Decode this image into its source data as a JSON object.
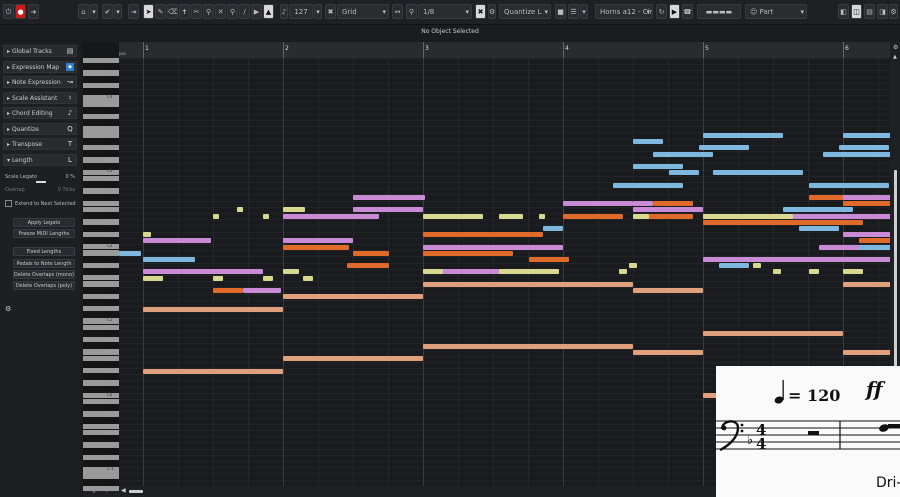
{
  "toolbar": {
    "snap_value": "127",
    "grid_type": "Grid",
    "grid_value": "1/8",
    "quantize": "Quantize L",
    "track_name": "Horns a12 - Cin.",
    "part_label": "Part"
  },
  "status": {
    "text": "No Object Selected"
  },
  "inspector": {
    "sections": [
      "Global Tracks",
      "Expression Map",
      "Note Expression",
      "Scale Assistant",
      "Chord Editing",
      "Quantize",
      "Transpose",
      "Length"
    ],
    "scale_legato_label": "Scale Legato",
    "scale_legato_value": "0 %",
    "overlap_label": "Overlap",
    "overlap_value": "0 Ticks",
    "extend_label": "Extend to Next Selected",
    "buttons": [
      "Apply Legato",
      "Freeze MIDI Lengths",
      "Fixed Lengths",
      "Pedals to Note Length",
      "Delete Overlaps (mono)",
      "Delete Overlaps (poly)"
    ]
  },
  "ruler": {
    "bars": [
      "1",
      "2",
      "3",
      "4",
      "5",
      "6"
    ],
    "start_label": "pos"
  },
  "piano": {
    "octave_labels": [
      "C4",
      "C3",
      "C2",
      "C1",
      "C0",
      "C-1"
    ]
  },
  "score": {
    "tempo_value": "= 120",
    "dynamic": "ff",
    "lyric": "Dri-"
  },
  "colors": {
    "orange": "#e06a2a",
    "salmon": "#e0a07c",
    "blue": "#7fb8df",
    "violet": "#c98ad6",
    "yellow": "#d8d890",
    "accent": "#2f7fd0"
  },
  "notes": [
    [
      "blue",
      0,
      6,
      58
    ],
    [
      "blue",
      1,
      20,
      58
    ],
    [
      "blue",
      1,
      136,
      58
    ],
    [
      "violet",
      1,
      30,
      44
    ],
    [
      "yellow",
      1,
      6,
      55
    ],
    [
      "yellow",
      1,
      21,
      57
    ],
    [
      "orange",
      1,
      73,
      84
    ],
    [
      "yellow",
      1,
      46,
      56
    ],
    [
      "yellow",
      1,
      76,
      78
    ],
    [
      "violet",
      1,
      57,
      56
    ],
    [
      "violet",
      1,
      68,
      60
    ],
    [
      "yellow",
      1,
      59,
      49
    ],
    [
      "salmon",
      1,
      35,
      67
    ],
    [
      "salmon",
      1,
      55,
      77
    ],
    [
      "violet",
      2,
      75,
      66
    ],
    [
      "orange",
      2,
      21,
      56
    ],
    [
      "yellow",
      2,
      7,
      49
    ],
    [
      "violet",
      2,
      9,
      47
    ],
    [
      "violet",
      2,
      33,
      46
    ],
    [
      "violet",
      2,
      0,
      52
    ],
    [
      "violet",
      2,
      38,
      56
    ],
    [
      "orange",
      2,
      45,
      56
    ],
    [
      "yellow",
      2,
      49,
      50
    ],
    [
      "yellow",
      2,
      56,
      49
    ],
    [
      "violet",
      2,
      75,
      49
    ],
    [
      "salmon",
      2,
      15,
      65
    ],
    [
      "yellow",
      2,
      79,
      50
    ],
    [
      "violet",
      2,
      85,
      53
    ],
    [
      "yellow",
      3,
      9,
      56
    ],
    [
      "violet",
      3,
      12,
      48
    ],
    [
      "blue",
      3,
      14,
      48
    ],
    [
      "yellow",
      3,
      15,
      54
    ],
    [
      "orange",
      3,
      17,
      46
    ],
    [
      "yellow",
      3,
      23,
      50
    ],
    [
      "violet",
      3,
      5,
      54
    ],
    [
      "yellow",
      3,
      21,
      56
    ],
    [
      "violet",
      3,
      22,
      53
    ],
    [
      "salmon",
      3,
      39,
      47
    ],
    [
      "salmon",
      3,
      65,
      55
    ],
    [
      "violet",
      3,
      10,
      60
    ],
    [
      "orange",
      3,
      24,
      55
    ],
    [
      "yellow",
      3,
      34,
      50
    ],
    [
      "violet",
      3,
      20,
      58
    ],
    [
      "yellow",
      3,
      33,
      51
    ],
    [
      "orange",
      3,
      46,
      50
    ],
    [
      "yellow",
      3,
      50,
      50
    ],
    [
      "violet",
      3,
      61,
      50
    ],
    [
      "yellow",
      3,
      54,
      51
    ],
    [
      "violet",
      3,
      47,
      48
    ],
    [
      "yellow",
      3,
      60,
      49
    ],
    [
      "salmon",
      3,
      41,
      49
    ],
    [
      "yellow",
      3,
      63,
      47
    ],
    [
      "blue",
      3,
      69,
      57
    ],
    [
      "violet",
      3,
      69,
      62
    ],
    [
      "orange",
      3,
      42,
      47
    ],
    [
      "blue",
      4,
      2,
      57
    ],
    [
      "blue",
      4,
      9,
      52
    ],
    [
      "blue",
      4,
      14,
      42
    ],
    [
      "blue",
      4,
      17,
      48
    ],
    [
      "blue",
      4,
      20,
      43
    ],
    [
      "blue",
      4,
      28,
      50
    ],
    [
      "blue",
      4,
      50,
      42
    ],
    [
      "blue",
      4,
      48,
      40
    ],
    [
      "orange",
      4,
      41,
      55
    ],
    [
      "yellow",
      4,
      44,
      47
    ],
    [
      "violet",
      4,
      35,
      50
    ],
    [
      "violet",
      4,
      56,
      46
    ],
    [
      "yellow",
      4,
      72,
      47
    ],
    [
      "blue",
      4,
      62,
      58
    ],
    [
      "salmon",
      4,
      35,
      42
    ],
    [
      "salmon",
      4,
      54,
      40
    ],
    [
      "salmon",
      4,
      66,
      42
    ],
    [
      "blue",
      4,
      70,
      40
    ],
    [
      "orange",
      4,
      74,
      49
    ],
    [
      "yellow",
      4,
      77,
      52
    ],
    [
      "violet",
      4,
      66,
      55
    ]
  ]
}
